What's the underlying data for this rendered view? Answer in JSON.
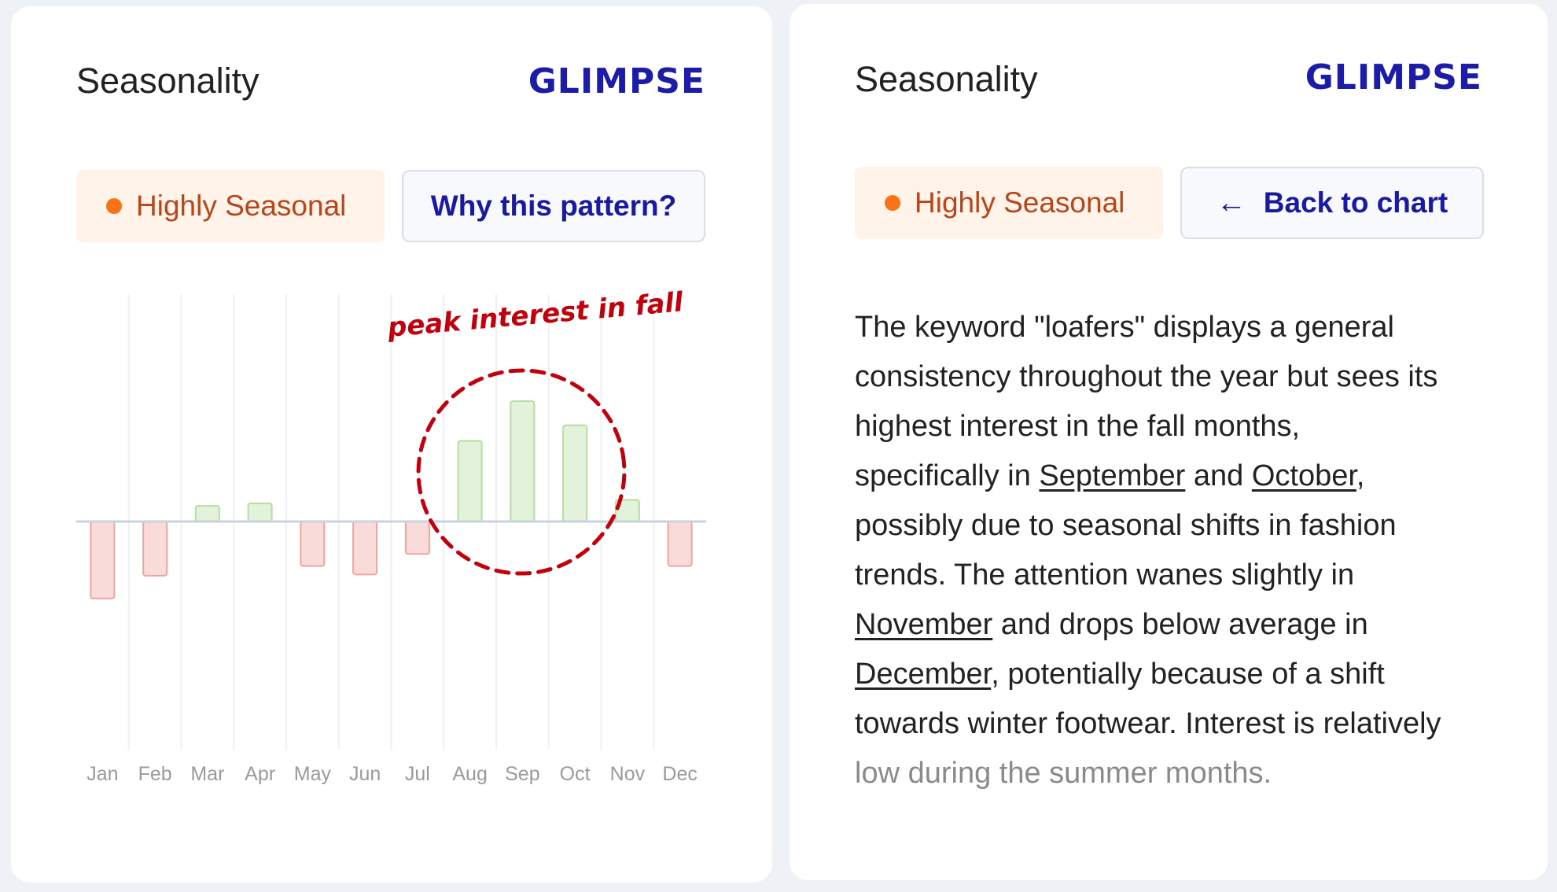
{
  "left_card": {
    "title": "Seasonality",
    "logo": "GLIMPSE",
    "badge": "Highly Seasonal",
    "pattern_button": "Why this pattern?",
    "annotation": "peak interest in fall"
  },
  "right_card": {
    "title": "Seasonality",
    "logo": "GLIMPSE",
    "badge": "Highly Seasonal",
    "back_button": "Back to chart",
    "back_icon": "arrow-left-icon",
    "lines": [
      [
        "The keyword \"loafers\" displays a general"
      ],
      [
        "consistency throughout the year but sees its"
      ],
      [
        "highest interest in the fall months,"
      ],
      [
        "specifically in ",
        "September",
        " and ",
        "October",
        ","
      ],
      [
        "possibly due to seasonal shifts in fashion"
      ],
      [
        "trends. The attention wanes slightly in"
      ],
      [
        "November",
        " and drops below average in"
      ],
      [
        "December",
        ", potentially because of a shift"
      ],
      [
        "towards winter footwear. Interest is relatively"
      ],
      [
        "low during the summer months."
      ]
    ]
  },
  "colors": {
    "brand": "#1c1ca8",
    "badge_text": "#b8461b",
    "badge_dot": "#f97316",
    "positive": "#e3f2da",
    "negative": "#f9dcda",
    "annotation": "#c0000c"
  },
  "chart_data": {
    "type": "bar",
    "categories": [
      "Jan",
      "Feb",
      "Mar",
      "Apr",
      "May",
      "Jun",
      "Jul",
      "Aug",
      "Sep",
      "Oct",
      "Nov",
      "Dec"
    ],
    "values": [
      -64,
      -45,
      13,
      15,
      -37,
      -44,
      -27,
      67,
      100,
      80,
      18,
      -37
    ],
    "title": "",
    "xlabel": "",
    "ylabel": "",
    "grid": "vertical",
    "annotation": "peak interest in fall",
    "highlighted": [
      "Aug",
      "Sep",
      "Oct"
    ]
  }
}
